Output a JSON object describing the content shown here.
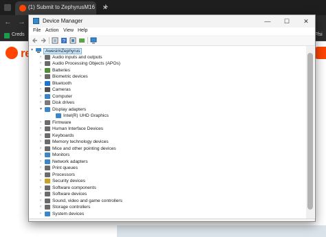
{
  "browser": {
    "tab_title": "(1) Submit to ZephyrusM16",
    "tab_close": "✕",
    "new_tab": "+",
    "nav_back": "←",
    "nav_forward": "→",
    "bookmark_label": "Creds",
    "bookmark_right": "OFfsi",
    "site_logo_text": "re",
    "brand_color": "#ff4500"
  },
  "device_manager": {
    "title": "Device Manager",
    "window_buttons": {
      "minimize": "—",
      "maximize": "☐",
      "close": "✕"
    },
    "menu": [
      "File",
      "Action",
      "View",
      "Help"
    ],
    "toolbar_icons": [
      "back-icon",
      "forward-icon",
      "properties-icon",
      "help-icon",
      "scan-icon",
      "update-driver-icon",
      "monitor-icon"
    ],
    "root": "AwesimZephyrus",
    "tree": [
      {
        "label": "Audio inputs and outputs",
        "expanded": false,
        "icon": "speaker-icon",
        "color": "#6b6b6b"
      },
      {
        "label": "Audio Processing Objects (APOs)",
        "expanded": false,
        "icon": "speaker-icon",
        "color": "#6b6b6b"
      },
      {
        "label": "Batteries",
        "expanded": false,
        "icon": "battery-icon",
        "color": "#4f8f3a"
      },
      {
        "label": "Biometric devices",
        "expanded": false,
        "icon": "fingerprint-icon",
        "color": "#6b6b6b"
      },
      {
        "label": "Bluetooth",
        "expanded": false,
        "icon": "bluetooth-icon",
        "color": "#1e73d6"
      },
      {
        "label": "Cameras",
        "expanded": false,
        "icon": "camera-icon",
        "color": "#505050"
      },
      {
        "label": "Computer",
        "expanded": false,
        "icon": "computer-icon",
        "color": "#3a86c8"
      },
      {
        "label": "Disk drives",
        "expanded": false,
        "icon": "disk-icon",
        "color": "#7a7a7a"
      },
      {
        "label": "Display adapters",
        "expanded": true,
        "icon": "display-icon",
        "color": "#3a86c8"
      },
      {
        "label": "Intel(R) UHD Graphics",
        "child": true,
        "icon": "display-icon",
        "color": "#3a86c8"
      },
      {
        "label": "Firmware",
        "expanded": false,
        "icon": "chip-icon",
        "color": "#6b6b6b"
      },
      {
        "label": "Human Interface Devices",
        "expanded": false,
        "icon": "hid-icon",
        "color": "#6b6b6b"
      },
      {
        "label": "Keyboards",
        "expanded": false,
        "icon": "keyboard-icon",
        "color": "#6b6b6b"
      },
      {
        "label": "Memory technology devices",
        "expanded": false,
        "icon": "memory-icon",
        "color": "#6b6b6b"
      },
      {
        "label": "Mice and other pointing devices",
        "expanded": false,
        "icon": "mouse-icon",
        "color": "#6b6b6b"
      },
      {
        "label": "Monitors",
        "expanded": false,
        "icon": "monitor-icon",
        "color": "#3a86c8"
      },
      {
        "label": "Network adapters",
        "expanded": false,
        "icon": "network-icon",
        "color": "#3a86c8"
      },
      {
        "label": "Print queues",
        "expanded": false,
        "icon": "printer-icon",
        "color": "#6b6b6b"
      },
      {
        "label": "Processors",
        "expanded": false,
        "icon": "cpu-icon",
        "color": "#6b6b6b"
      },
      {
        "label": "Security devices",
        "expanded": false,
        "icon": "security-icon",
        "color": "#c9a227"
      },
      {
        "label": "Software components",
        "expanded": false,
        "icon": "software-icon",
        "color": "#6b6b6b"
      },
      {
        "label": "Software devices",
        "expanded": false,
        "icon": "software-icon",
        "color": "#6b6b6b"
      },
      {
        "label": "Sound, video and game controllers",
        "expanded": false,
        "icon": "speaker-icon",
        "color": "#6b6b6b"
      },
      {
        "label": "Storage controllers",
        "expanded": false,
        "icon": "storage-icon",
        "color": "#6b6b6b"
      },
      {
        "label": "System devices",
        "expanded": false,
        "icon": "system-icon",
        "color": "#3a86c8"
      }
    ]
  }
}
